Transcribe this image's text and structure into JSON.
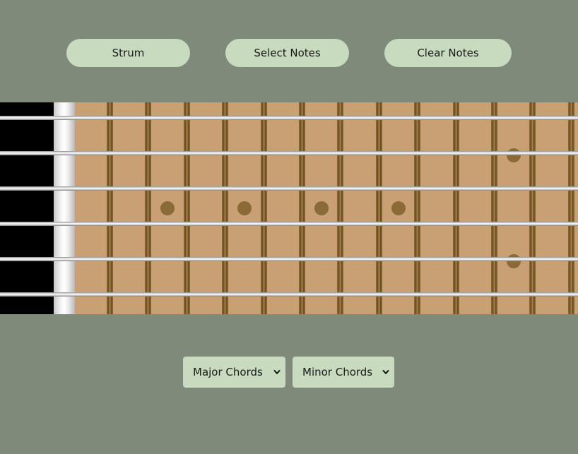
{
  "toolbar": {
    "strum_label": "Strum",
    "select_label": "Select Notes",
    "clear_label": "Clear Notes"
  },
  "fretboard": {
    "strings": 6,
    "frets": 12,
    "inlay_frets_single": [
      3,
      5,
      7,
      9
    ],
    "inlay_fret_double": 12,
    "colors": {
      "background": "#7f8a7a",
      "wood": "#c9a074",
      "fret": "#8a6a36",
      "inlay": "#8a6a36",
      "headstock": "#000000",
      "button": "#c8dbbf"
    }
  },
  "chord_selectors": {
    "major": {
      "selected": "Major Chords",
      "icon": "chevron-down-icon"
    },
    "minor": {
      "selected": "Minor Chords",
      "icon": "chevron-down-icon"
    }
  }
}
